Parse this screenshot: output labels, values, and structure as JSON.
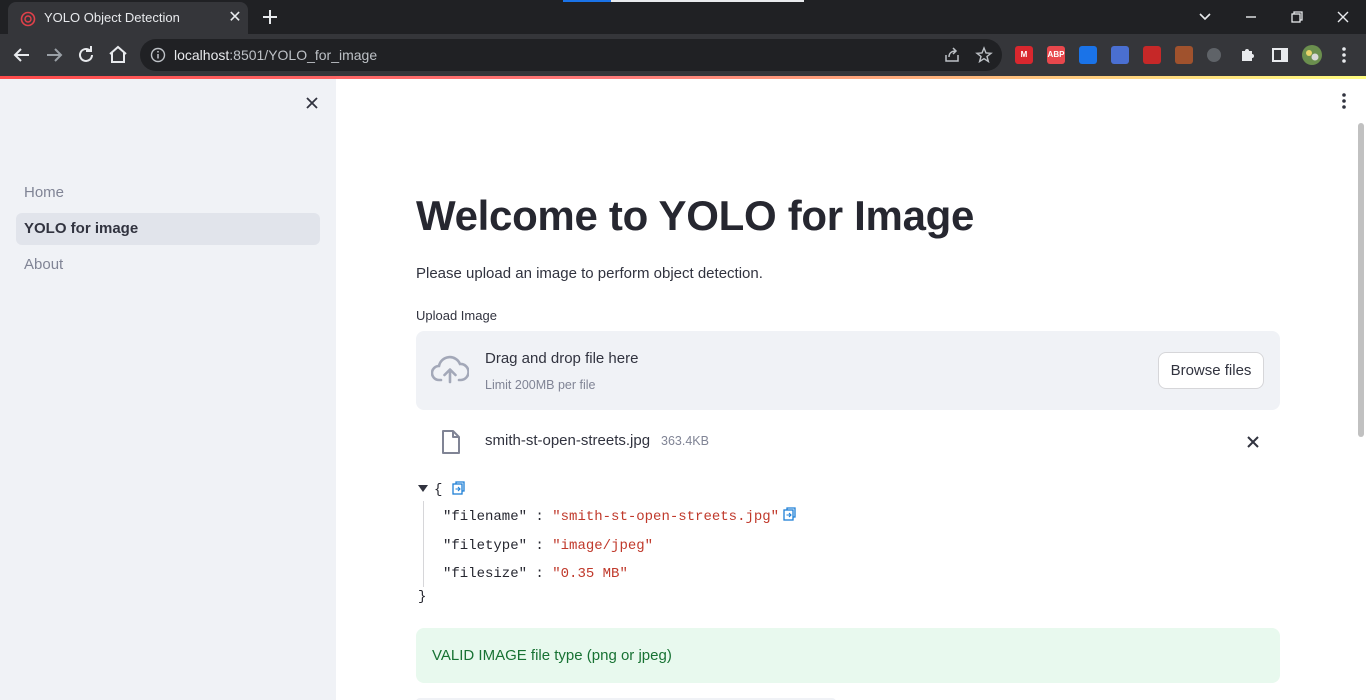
{
  "browser": {
    "tab_title": "YOLO Object Detection",
    "url_host": "localhost",
    "url_rest": ":8501/YOLO_for_image",
    "extensions": [
      {
        "name": "mega-extension",
        "label": "M",
        "color": "#d9272e"
      },
      {
        "name": "adblock-plus-extension",
        "label": "ABP",
        "color": "#e8474c"
      },
      {
        "name": "bookmark-extension",
        "label": "",
        "color": "#1a73e8"
      },
      {
        "name": "save-extension",
        "label": "",
        "color": "#4a6fd1"
      },
      {
        "name": "chart-extension",
        "label": "",
        "color": "#c62828"
      },
      {
        "name": "cookie-extension",
        "label": "",
        "color": "#a0522d"
      },
      {
        "name": "inactive-extension",
        "label": "",
        "color": "#5f6368"
      }
    ]
  },
  "sidebar": {
    "items": [
      {
        "label": "Home",
        "active": false
      },
      {
        "label": "YOLO for image",
        "active": true
      },
      {
        "label": "About",
        "active": false
      }
    ]
  },
  "main": {
    "title": "Welcome to YOLO for Image",
    "intro": "Please upload an image to perform object detection.",
    "upload_label": "Upload Image",
    "dropzone": {
      "text": "Drag and drop file here",
      "limit": "Limit 200MB per file",
      "browse_label": "Browse files"
    },
    "file": {
      "name": "smith-st-open-streets.jpg",
      "size": "363.4KB"
    },
    "json": {
      "open_brace": "{",
      "close_brace": "}",
      "rows": [
        {
          "key": "\"filename\"",
          "sep": " : ",
          "value": "\"smith-st-open-streets.jpg\""
        },
        {
          "key": "\"filetype\"",
          "sep": " : ",
          "value": "\"image/jpeg\""
        },
        {
          "key": "\"filesize\"",
          "sep": " : ",
          "value": "\"0.35 MB\""
        }
      ]
    },
    "alert": "VALID IMAGE file type (png or jpeg)"
  }
}
